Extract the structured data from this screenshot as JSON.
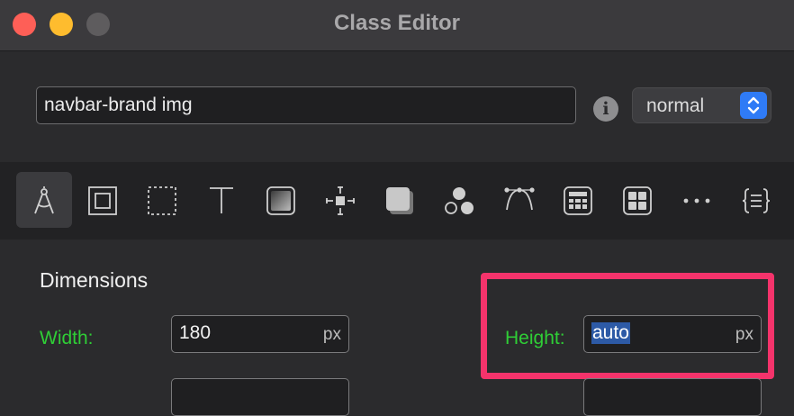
{
  "window": {
    "title": "Class Editor"
  },
  "selector": {
    "value": "navbar-brand img",
    "state": "normal"
  },
  "toolbar": {
    "tools": [
      "compass-icon",
      "box-model-icon",
      "border-dashed-icon",
      "text-icon",
      "gradient-icon",
      "spacing-icon",
      "shadow-icon",
      "circles-icon",
      "bezier-icon",
      "table-icon",
      "grid-icon",
      "more-icon",
      "css-code-icon"
    ]
  },
  "dimensions": {
    "heading": "Dimensions",
    "width_label": "Width:",
    "width_value": "180",
    "width_unit": "px",
    "height_label": "Height:",
    "height_value": "auto",
    "height_unit": "px"
  },
  "colors": {
    "accent_green": "#2fce36",
    "highlight": "#f5336b",
    "select_blue": "#2f7bf6"
  }
}
